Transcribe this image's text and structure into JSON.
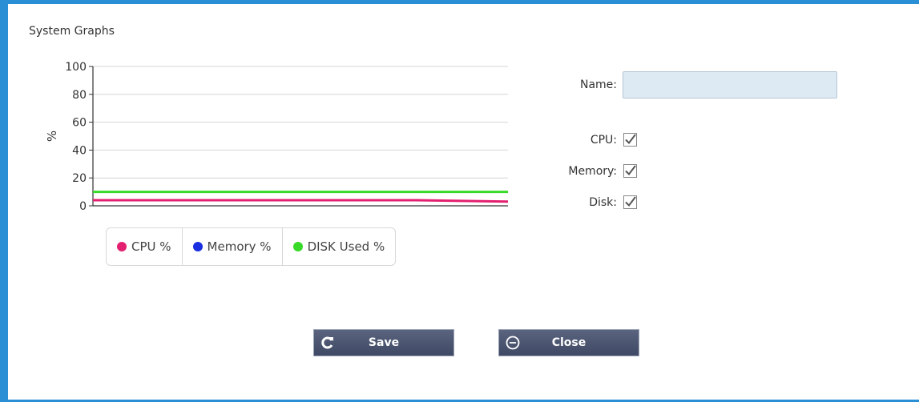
{
  "panel": {
    "title": "System Graphs"
  },
  "form": {
    "name_label": "Name:",
    "name_value": "",
    "checkboxes": [
      {
        "label": "CPU:",
        "checked": true
      },
      {
        "label": "Memory:",
        "checked": true
      },
      {
        "label": "Disk:",
        "checked": true
      }
    ]
  },
  "buttons": {
    "save_label": "Save",
    "close_label": "Close"
  },
  "colors": {
    "frame": "#2a8fd4",
    "cpu": "#e3206f",
    "memory": "#1a2fe0",
    "disk": "#38d928"
  },
  "chart_data": {
    "type": "line",
    "ylabel": "%",
    "xlabel": "",
    "ylim": [
      0,
      100
    ],
    "yticks": [
      "100",
      "80",
      "60",
      "40",
      "20",
      "0"
    ],
    "grid": true,
    "legend_position": "bottom",
    "series": [
      {
        "name": "CPU %",
        "color": "#e3206f",
        "values": [
          4,
          4,
          4,
          4,
          4,
          4,
          4,
          4,
          3.5,
          3
        ]
      },
      {
        "name": "Memory %",
        "color": "#1a2fe0",
        "values": []
      },
      {
        "name": "DISK Used %",
        "color": "#38d928",
        "values": [
          10,
          10,
          10,
          10,
          10,
          10,
          10,
          10,
          10,
          10
        ]
      }
    ]
  }
}
